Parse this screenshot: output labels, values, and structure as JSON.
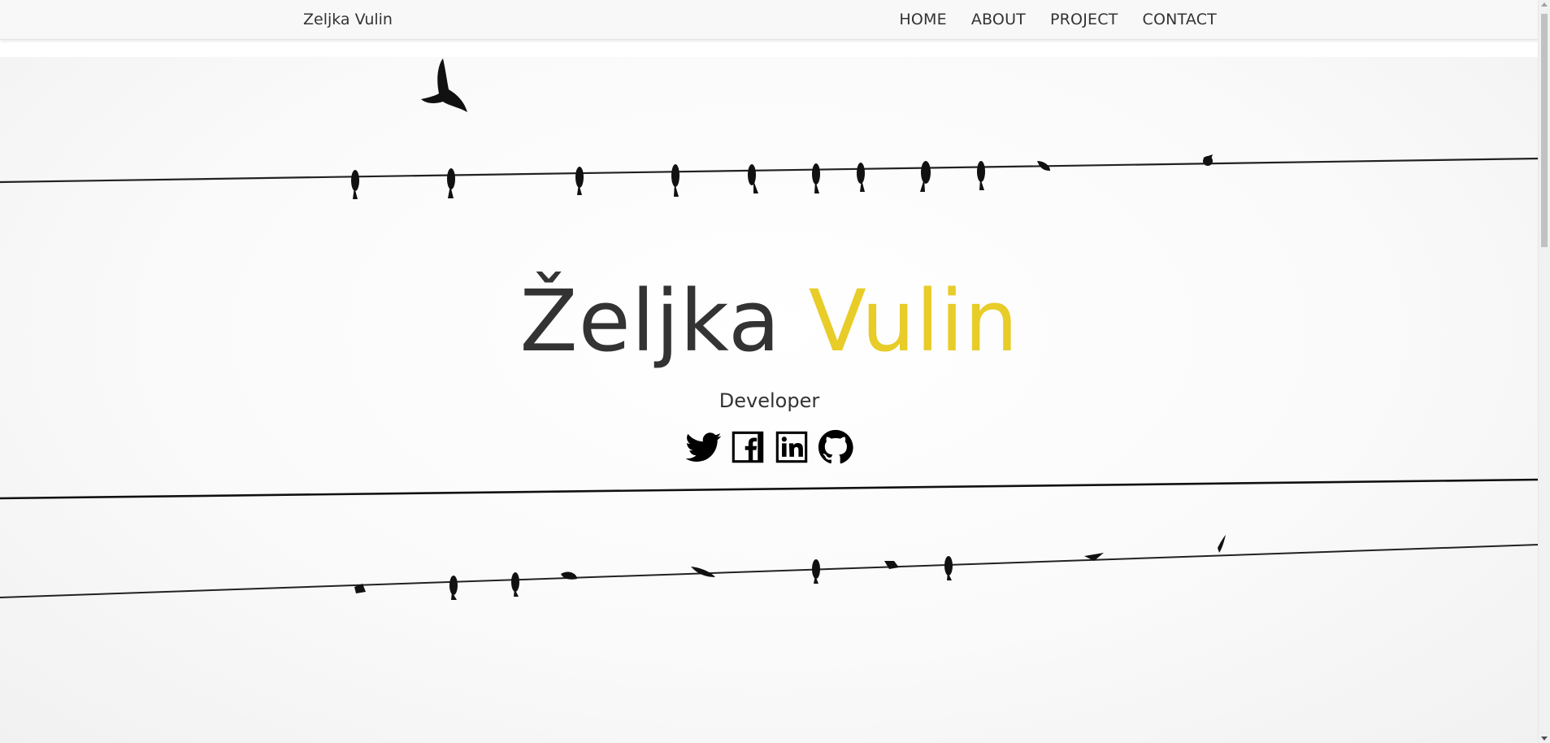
{
  "navbar": {
    "brand": "Zeljka Vulin",
    "links": [
      {
        "label": "HOME"
      },
      {
        "label": "ABOUT"
      },
      {
        "label": "PROJECT"
      },
      {
        "label": "CONTACT"
      }
    ]
  },
  "hero": {
    "first_name": "Željka",
    "last_name": "Vulin",
    "subtitle": "Developer",
    "accent_color": "#e8cc27",
    "social": [
      {
        "icon": "twitter-icon"
      },
      {
        "icon": "facebook-icon"
      },
      {
        "icon": "linkedin-icon"
      },
      {
        "icon": "github-icon"
      }
    ]
  }
}
